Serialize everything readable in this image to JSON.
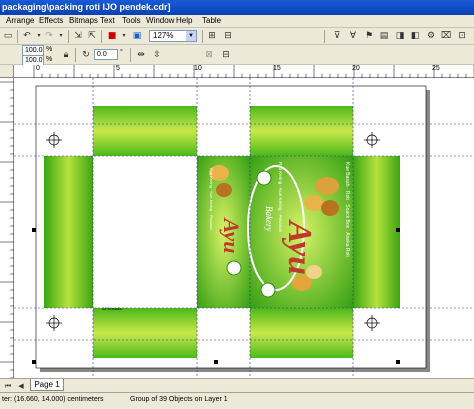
{
  "window": {
    "title": "packaging\\packing roti IJO pendek.cdr]"
  },
  "menu": {
    "items": [
      "Arrange",
      "Effects",
      "Bitmaps",
      "Text",
      "Tools",
      "Window",
      "Help",
      "Table"
    ]
  },
  "toolbar": {
    "zoom_value": "127%",
    "width_value": "100.0",
    "height_value": "100.0",
    "percent_symbol": "%",
    "rotation_value": "0.0",
    "degree_symbol": "°"
  },
  "ruler": {
    "h_labels": [
      "0",
      "5",
      "10",
      "15",
      "20",
      "25",
      "30"
    ]
  },
  "artwork": {
    "brand": "Ayu",
    "brand_sub": "Bakery",
    "tagline_top": "Kue Basah · Roti · Snack Box · Aneka Roti",
    "tagline_bottom": "Roti Kering · Kue Kering · Pesanan",
    "flap_label": "Ali Nosadis"
  },
  "tabs": {
    "page1": "Page 1"
  },
  "status": {
    "coords": "ter: (16.660, 14.000)  centimeters",
    "selection": "Group of 39 Objects on Layer 1"
  },
  "colors": {
    "title_bar": "#0a3fb4",
    "package_green": "#5ec51f",
    "package_dark": "#2e8c0f"
  }
}
